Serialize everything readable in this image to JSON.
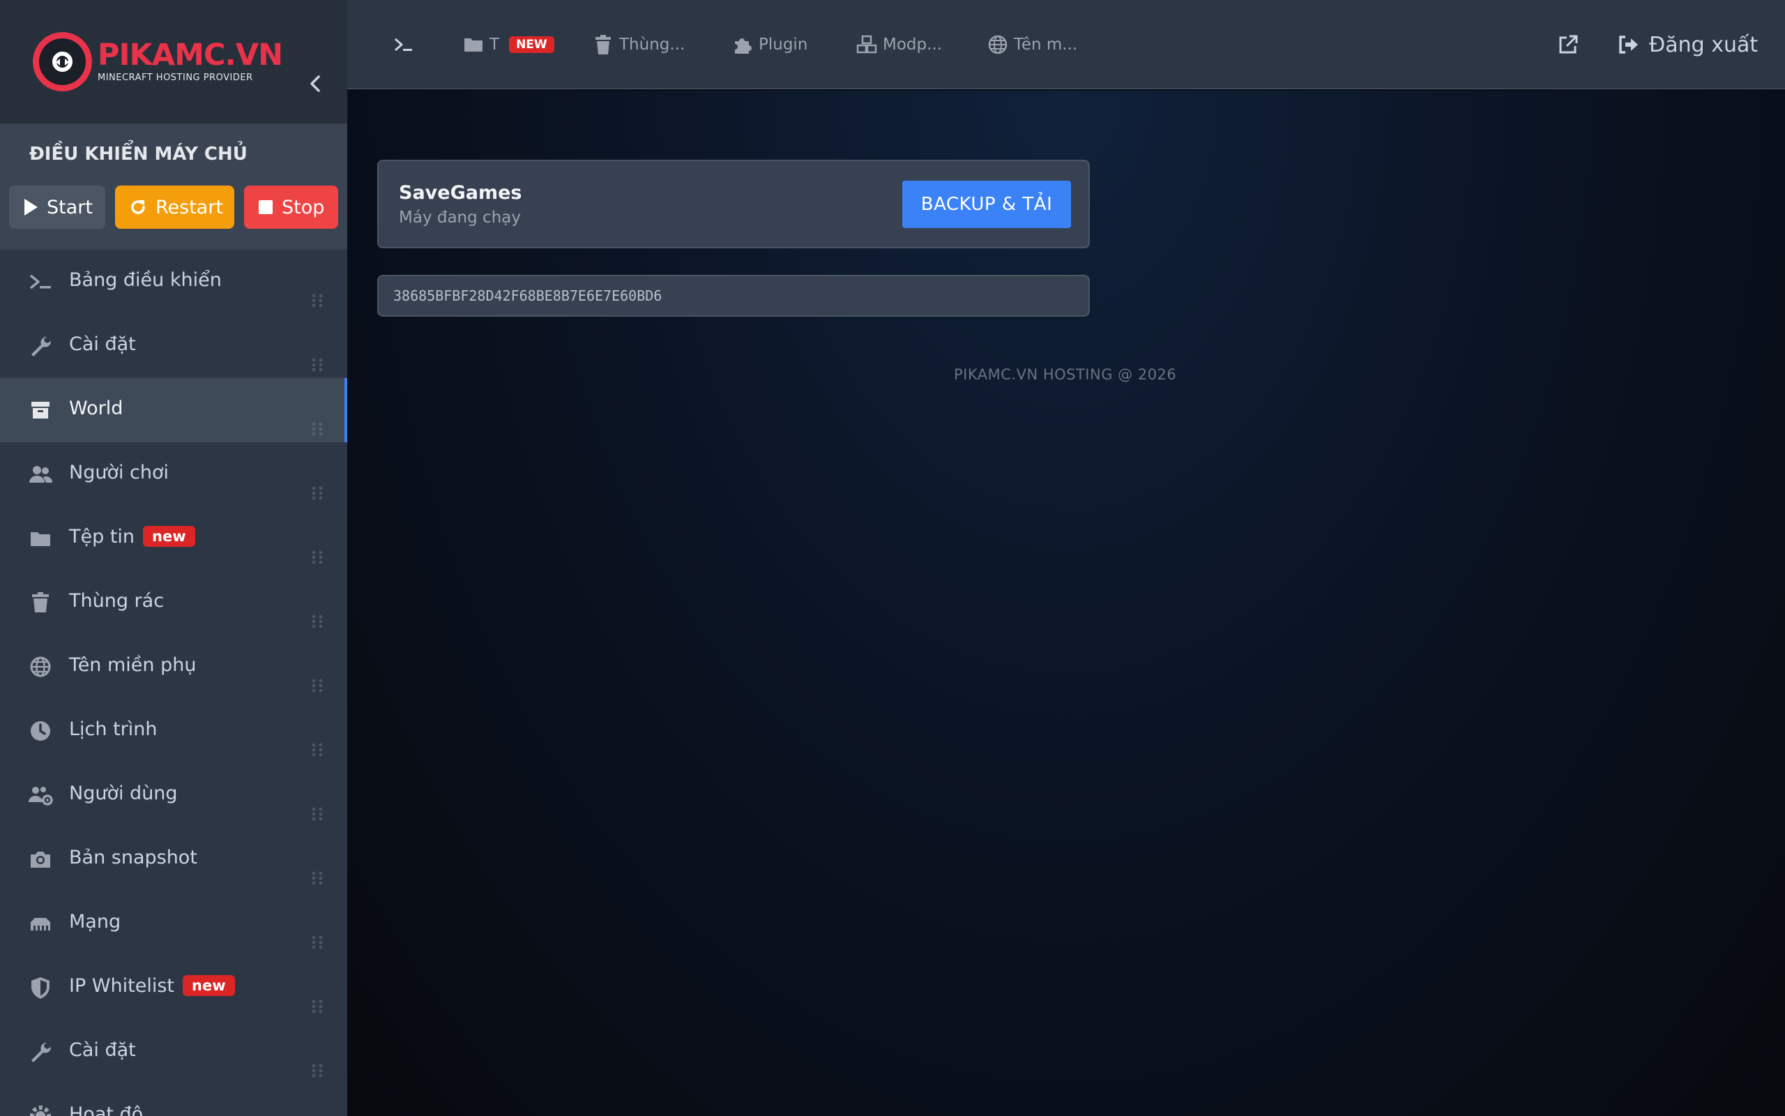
{
  "brand": {
    "name": "PIKAMC.VN",
    "tagline": "MINECRAFT HOSTING PROVIDER"
  },
  "server_control": {
    "title": "ĐIỀU KHIỂN MÁY CHỦ",
    "start_label": "Start",
    "restart_label": "Restart",
    "stop_label": "Stop"
  },
  "sidebar": {
    "items": [
      {
        "label": "Bảng điều khiển",
        "icon": "terminal-icon"
      },
      {
        "label": "Cài đặt",
        "icon": "wrench-icon"
      },
      {
        "label": "World",
        "icon": "archive-box-icon",
        "active": true
      },
      {
        "label": "Người chơi",
        "icon": "users-icon"
      },
      {
        "label": "Tệp tin",
        "icon": "folder-icon",
        "badge": "new"
      },
      {
        "label": "Thùng rác",
        "icon": "trash-icon"
      },
      {
        "label": "Tên miền phụ",
        "icon": "globe-icon"
      },
      {
        "label": "Lịch trình",
        "icon": "clock-icon"
      },
      {
        "label": "Người dùng",
        "icon": "users-cog-icon"
      },
      {
        "label": "Bản snapshot",
        "icon": "camera-icon"
      },
      {
        "label": "Mạng",
        "icon": "network-icon"
      },
      {
        "label": "IP Whitelist",
        "icon": "shield-icon",
        "badge": "new"
      },
      {
        "label": "Cài đặt",
        "icon": "wrench-icon"
      },
      {
        "label": "Hoạt độ...",
        "icon": "gear-icon"
      }
    ]
  },
  "topbar": {
    "items": [
      {
        "label": "",
        "icon": "terminal-icon"
      },
      {
        "label": "T",
        "icon": "folder-icon",
        "badge": "NEW"
      },
      {
        "label": "Thùng...",
        "icon": "trash-icon"
      },
      {
        "label": "Plugin",
        "icon": "puzzle-icon"
      },
      {
        "label": "Modp...",
        "icon": "cubes-icon"
      },
      {
        "label": "Tên m...",
        "icon": "globe-icon"
      }
    ],
    "open_external_icon": "external-link-icon",
    "logout_label": "Đăng xuất"
  },
  "main": {
    "card": {
      "title": "SaveGames",
      "status": "Máy đang chạy",
      "backup_label": "BACKUP & TẢI"
    },
    "id_value": "38685BFBF28D42F68BE8B7E6E7E60BD6",
    "footer": "PIKAMC.VN HOSTING @ 2026"
  },
  "colors": {
    "accent": "#3b82f6",
    "brand": "#e8334a",
    "start": "#4b5563",
    "restart": "#f59e0b",
    "stop": "#ef4444",
    "badge": "#dc2626"
  }
}
